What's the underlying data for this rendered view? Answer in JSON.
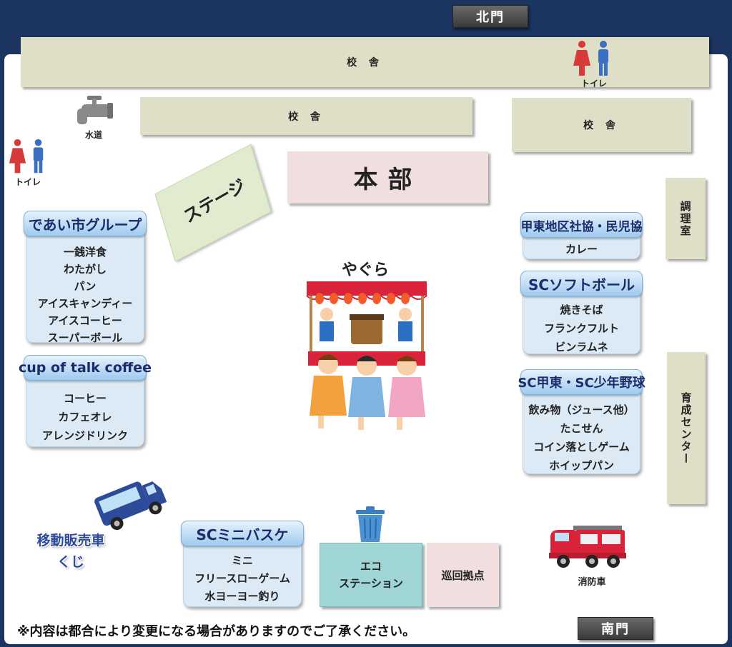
{
  "gates": {
    "north": "北門",
    "south": "南門"
  },
  "buildings": {
    "school_top": "校 舎",
    "school_mid": "校 舎",
    "school_right": "校 舎",
    "kitchen": "調理室",
    "training_center": "育成センター"
  },
  "facilities": {
    "toilet_top": "トイレ",
    "toilet_left": "トイレ",
    "water": "水道",
    "honbu": "本部",
    "stage": "ステージ",
    "yagura": "やぐら",
    "eco_station": [
      "エコ",
      "ステーション"
    ],
    "patrol": "巡回拠点",
    "fire_truck": "消防車",
    "mobile_vendor": [
      "移動販売車",
      "くじ"
    ]
  },
  "booths": {
    "deai": {
      "title": "であい市グループ",
      "items": [
        "一銭洋食",
        "わたがし",
        "パン",
        "アイスキャンディー",
        "アイスコーヒー",
        "スーパーボール"
      ]
    },
    "cup": {
      "title": "cup of talk coffee",
      "items": [
        "コーヒー",
        "カフェオレ",
        "アレンジドリンク"
      ]
    },
    "kotou": {
      "title": "甲東地区社協・民児協",
      "items": [
        "カレー"
      ]
    },
    "softball": {
      "title": "SCソフトボール",
      "items": [
        "焼きそば",
        "フランクフルト",
        "ビンラムネ"
      ]
    },
    "baseball": {
      "title": "SC甲東・SC少年野球",
      "items": [
        "飲み物（ジュース他）",
        "たこせん",
        "コイン落としゲーム",
        "ホイップパン"
      ]
    },
    "minibasket": {
      "title": "SCミニバスケ",
      "items": [
        "ミニ",
        "フリースローゲーム",
        "水ヨーヨー釣り"
      ]
    }
  },
  "notice": "※内容は都合により変更になる場合がありますのでご了承ください。",
  "colors": {
    "background": "#1b3560",
    "booth": "#dceaf6",
    "building": "#dfdfc8",
    "honbu": "#f1dfe0",
    "eco": "#9fd5d5"
  }
}
